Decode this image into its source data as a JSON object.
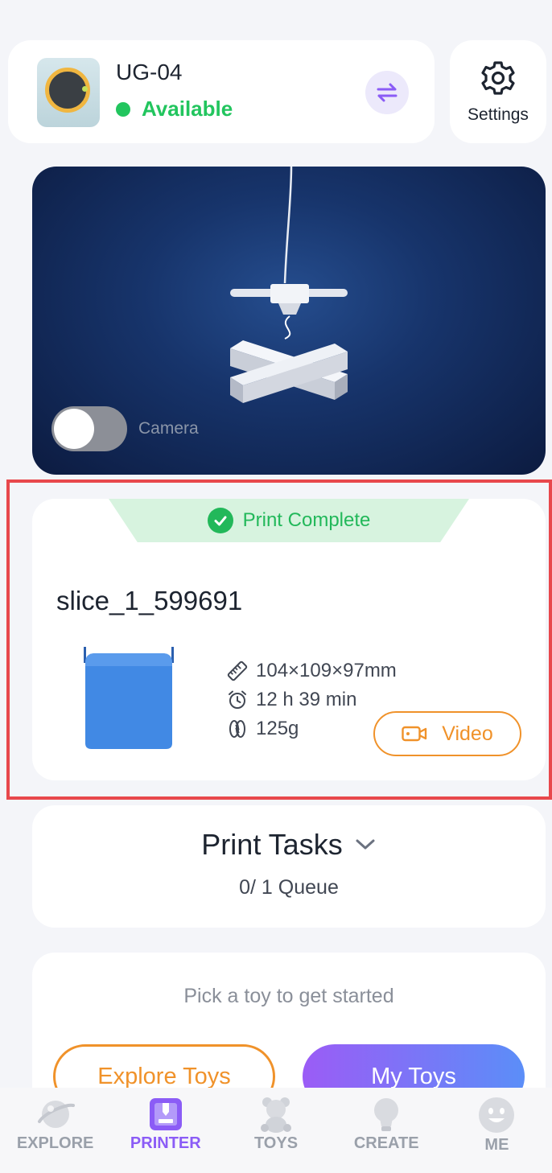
{
  "device": {
    "name": "UG-04",
    "status": "Available",
    "status_color": "#22c55e",
    "switch_icon": "swap-arrows-icon"
  },
  "settings": {
    "label": "Settings",
    "icon": "gear-icon"
  },
  "camera": {
    "label": "Camera",
    "enabled": false
  },
  "job": {
    "status": "Print Complete",
    "name": "slice_1_599691",
    "dimensions": "104×109×97mm",
    "duration": "12 h 39 min",
    "weight": "125g",
    "video_label": "Video"
  },
  "tasks": {
    "title": "Print Tasks",
    "queue": "0/ 1 Queue"
  },
  "toys": {
    "hint": "Pick a toy to get started",
    "explore_label": "Explore Toys",
    "my_toys_label": "My Toys"
  },
  "nav": {
    "items": [
      {
        "label": "EXPLORE",
        "icon": "planet-icon",
        "active": false
      },
      {
        "label": "PRINTER",
        "icon": "printer-icon",
        "active": true
      },
      {
        "label": "TOYS",
        "icon": "teddy-bear-icon",
        "active": false
      },
      {
        "label": "CREATE",
        "icon": "lightbulb-icon",
        "active": false
      },
      {
        "label": "ME",
        "icon": "smiley-icon",
        "active": false
      }
    ]
  },
  "colors": {
    "accent": "#8b5cf6",
    "orange": "#f0922a",
    "success": "#22b85a"
  }
}
